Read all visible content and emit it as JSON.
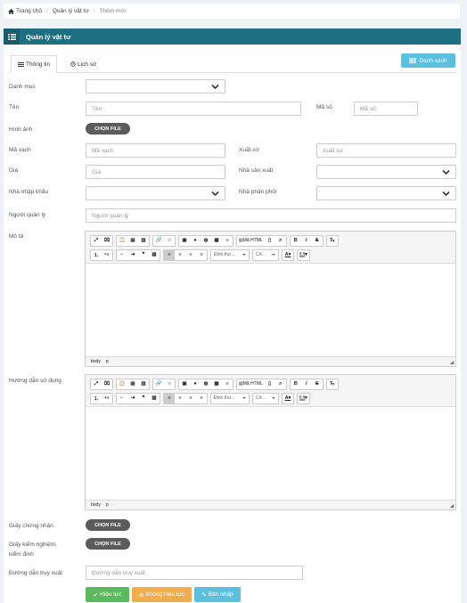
{
  "breadcrumb": {
    "home": "Trang chủ",
    "section": "Quản lý vật tư",
    "current": "Thêm mới"
  },
  "panel": {
    "title": "Quản lý vật tư"
  },
  "tabs": [
    {
      "label": "Thông tin"
    },
    {
      "label": "Lịch sử"
    }
  ],
  "list_button": "Danh sách",
  "form": {
    "category": {
      "label": "Danh mục",
      "value": ""
    },
    "name": {
      "label": "Tên",
      "placeholder": "Tên"
    },
    "code": {
      "label": "Mã số",
      "placeholder": "Mã số"
    },
    "image": {
      "label": "Hình ảnh",
      "button": "CHỌN FILE"
    },
    "barcode": {
      "label": "Mã vạch",
      "placeholder": "Mã vạch"
    },
    "origin": {
      "label": "Xuất xứ",
      "placeholder": "Xuất xứ"
    },
    "price": {
      "label": "Giá",
      "placeholder": "Giá"
    },
    "manufacturer": {
      "label": "Nhà sản xuất",
      "value": ""
    },
    "importer": {
      "label": "Nhà nhập khẩu",
      "value": ""
    },
    "distributor": {
      "label": "Nhà phân phối",
      "value": ""
    },
    "manager": {
      "label": "Người quản lý",
      "placeholder": "Người quản lý"
    },
    "description": {
      "label": "Mô tả"
    },
    "usage": {
      "label": "Hướng dẫn sử dụng"
    },
    "certificate": {
      "label": "Giấy chứng nhận",
      "button": "CHỌN FILE"
    },
    "test_cert": {
      "label_line1": "Giấy kiểm nghiệm,",
      "label_line2": "kiểm định",
      "button": "CHỌN FILE"
    },
    "trace_path": {
      "label": "Đường dẫn truy xuất",
      "placeholder": "Đường dẫn truy xuất"
    }
  },
  "editor": {
    "html_label": "Mã HTML",
    "format_label": "Định thư...",
    "size_label": "Cỡ...",
    "bold": "B",
    "italic": "I",
    "strike": "S",
    "status_body": "body",
    "status_p": "p"
  },
  "actions": {
    "active": "Hiệu lực",
    "inactive": "Không hiệu lực",
    "draft": "Bản nháp"
  },
  "colors": {
    "header": "#1f6f83",
    "info": "#5bc0de",
    "success": "#5cb85c",
    "warning": "#f0ad4e"
  }
}
